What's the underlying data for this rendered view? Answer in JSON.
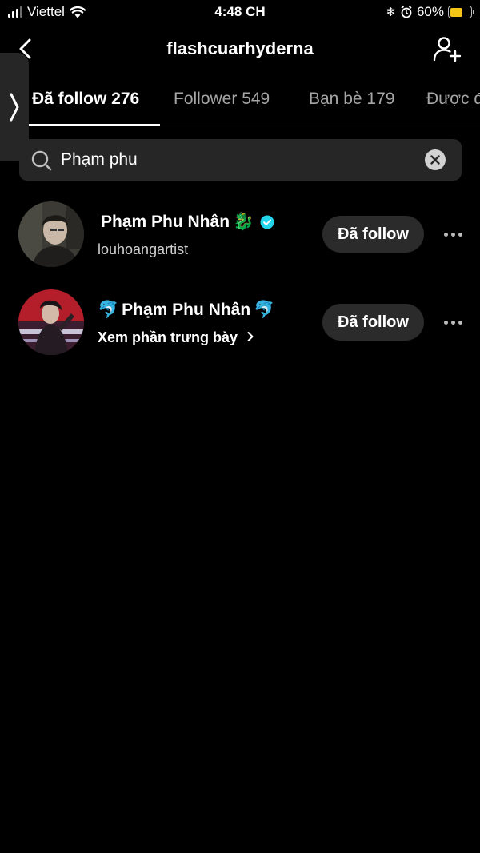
{
  "status_bar": {
    "carrier": "Viettel",
    "time": "4:48 CH",
    "battery": "60%",
    "battery_level": 0.6
  },
  "header": {
    "title": "flashcuarhyderna"
  },
  "tabs": [
    {
      "label": "Đã follow 276",
      "active": true
    },
    {
      "label": "Follower 549",
      "active": false
    },
    {
      "label": "Bạn bè 179",
      "active": false
    },
    {
      "label": "Được đ",
      "active": false
    }
  ],
  "search": {
    "value": "Phạm phu"
  },
  "results": [
    {
      "name": "Phạm Phu Nhân",
      "emoji_before": "",
      "emoji_after": "🐉",
      "verified": true,
      "subtitle": "louhoangartist",
      "button": "Đã follow"
    },
    {
      "name": "Phạm Phu Nhân",
      "emoji_before": "🐬",
      "emoji_after": "🐬",
      "verified": false,
      "subtitle": "Xem phần trưng bày",
      "button": "Đã follow"
    }
  ],
  "colors": {
    "background": "#000000",
    "button": "#2b2b2b",
    "search_bg": "#262626",
    "verified": "#20d5ec",
    "battery": "#f5c518"
  }
}
